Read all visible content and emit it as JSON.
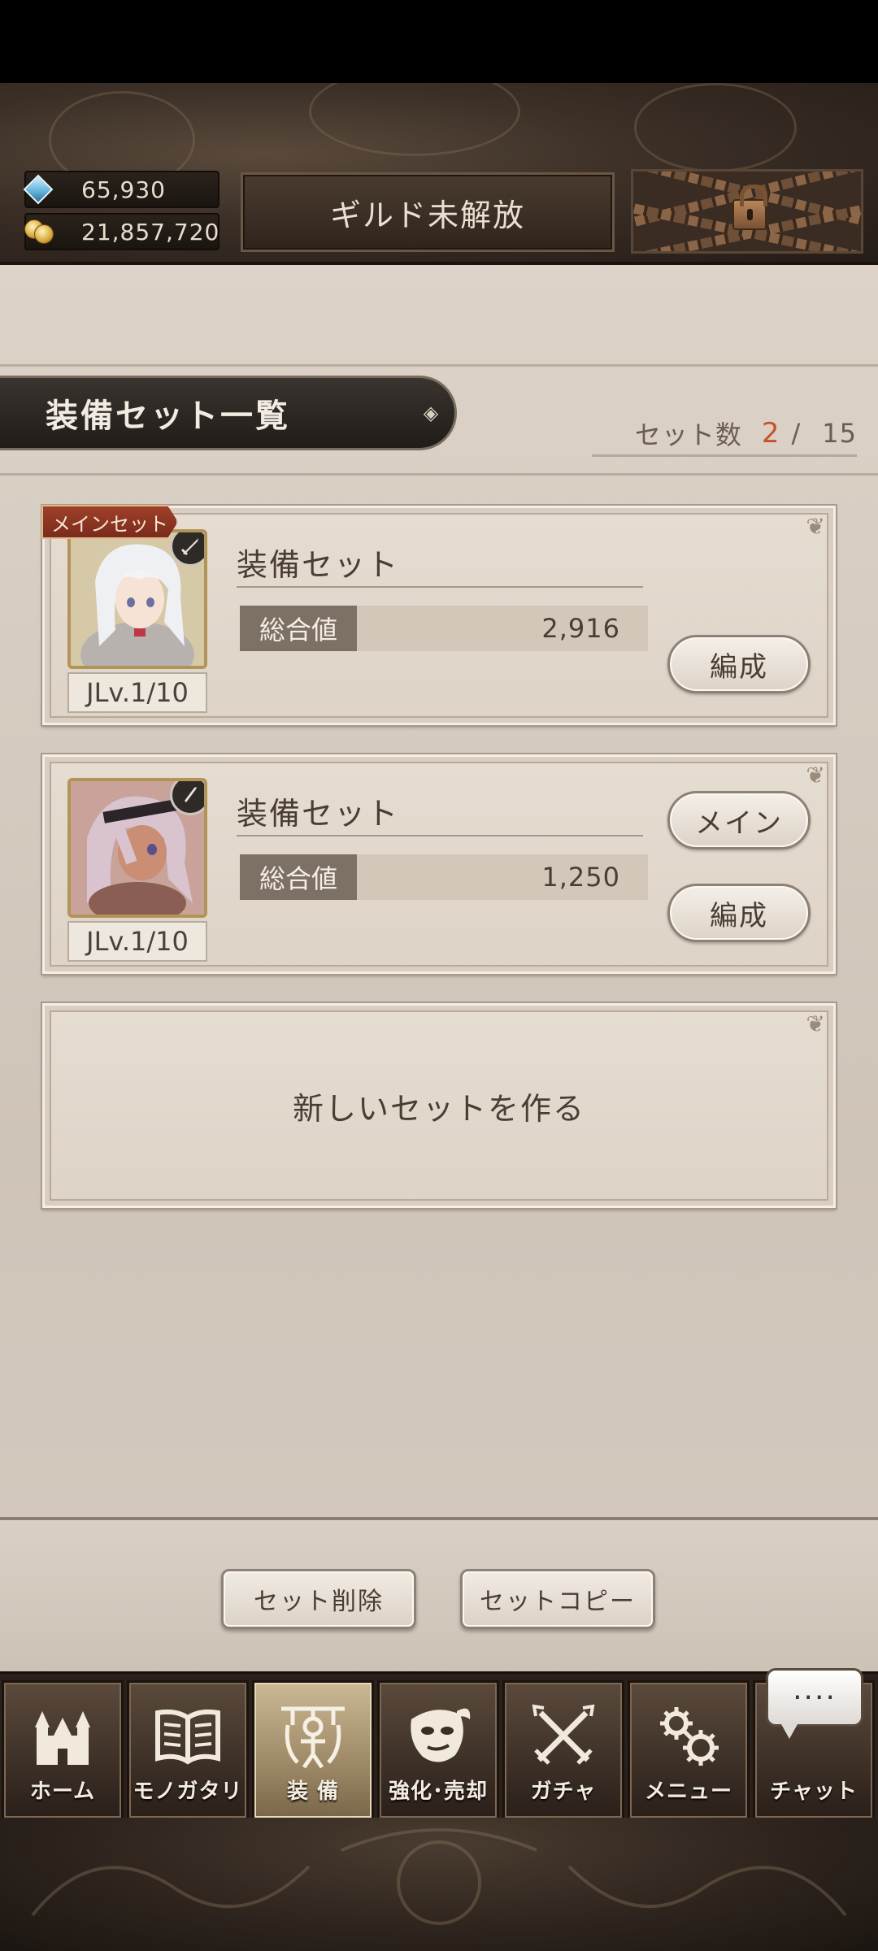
{
  "header": {
    "gems": "65,930",
    "gold": "21,857,720",
    "guild_button": "ギルド未解放",
    "lock_icon": "padlock-icon"
  },
  "list": {
    "title": "装備セット一覧",
    "count_label": "セット数",
    "count_current": "2",
    "count_separator": "/",
    "count_max": "15"
  },
  "sets": [
    {
      "tag": "メインセット",
      "name": "装備セット",
      "stat_label": "総合値",
      "stat_value": "2,916",
      "level": "JLv.1/10",
      "edit_label": "編成"
    },
    {
      "name": "装備セット",
      "stat_label": "総合値",
      "stat_value": "1,250",
      "level": "JLv.1/10",
      "main_label": "メイン",
      "edit_label": "編成"
    }
  ],
  "new_set_label": "新しいセットを作る",
  "actions": {
    "delete": "セット削除",
    "copy": "セットコピー"
  },
  "nav": {
    "items": [
      {
        "label": "ホーム",
        "icon": "castle-icon"
      },
      {
        "label": "モノガタリ",
        "icon": "book-icon"
      },
      {
        "label": "装 備",
        "icon": "equipment-icon"
      },
      {
        "label": "強化･売却",
        "icon": "mask-icon"
      },
      {
        "label": "ガチャ",
        "icon": "crossed-swords-icon"
      },
      {
        "label": "メニュー",
        "icon": "gears-icon"
      },
      {
        "label": "チャット",
        "icon": "chat-icon"
      }
    ],
    "active_index": 2,
    "chat_bubble": "····"
  },
  "colors": {
    "accent_count": "#c4532b",
    "main_tag": "#8e3422",
    "active_nav": "#b39d76"
  }
}
